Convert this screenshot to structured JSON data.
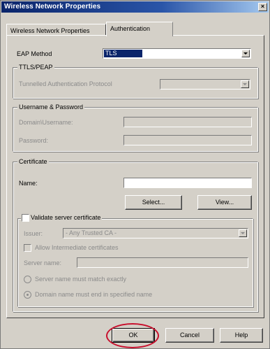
{
  "window": {
    "title": "Wireless Network Properties",
    "close_glyph": "×"
  },
  "tabs": [
    {
      "label": "Wireless Network Properties",
      "active": false
    },
    {
      "label": "Authentication",
      "active": true
    }
  ],
  "eap": {
    "label": "EAP Method",
    "value": "TLS"
  },
  "ttls_peap": {
    "title": "TTLS/PEAP",
    "tunnel_label": "Tunnelled Authentication Protocol",
    "tunnel_value": ""
  },
  "userpass": {
    "title": "Username & Password",
    "username_label": "Domain\\Username:",
    "password_label": "Password:"
  },
  "certificate": {
    "title": "Certificate",
    "name_label": "Name:",
    "name_value": "",
    "select_button": "Select...",
    "view_button": "View..."
  },
  "validate": {
    "checkbox_label": "Validate server certificate",
    "checked": false,
    "issuer_label": "Issuer:",
    "issuer_value": "- Any Trusted CA -",
    "allow_intermediate_label": "Allow Intermediate certificates",
    "server_name_label": "Server name:",
    "radio_exact": "Server name must match exactly",
    "radio_domain": "Domain name must end in specified name"
  },
  "footer": {
    "ok": "OK",
    "cancel": "Cancel",
    "help": "Help"
  },
  "colors": {
    "titlebar_start": "#0a246a",
    "titlebar_end": "#a6caf0",
    "face": "#d4d0c8",
    "highlight_circle": "#c8102e"
  }
}
